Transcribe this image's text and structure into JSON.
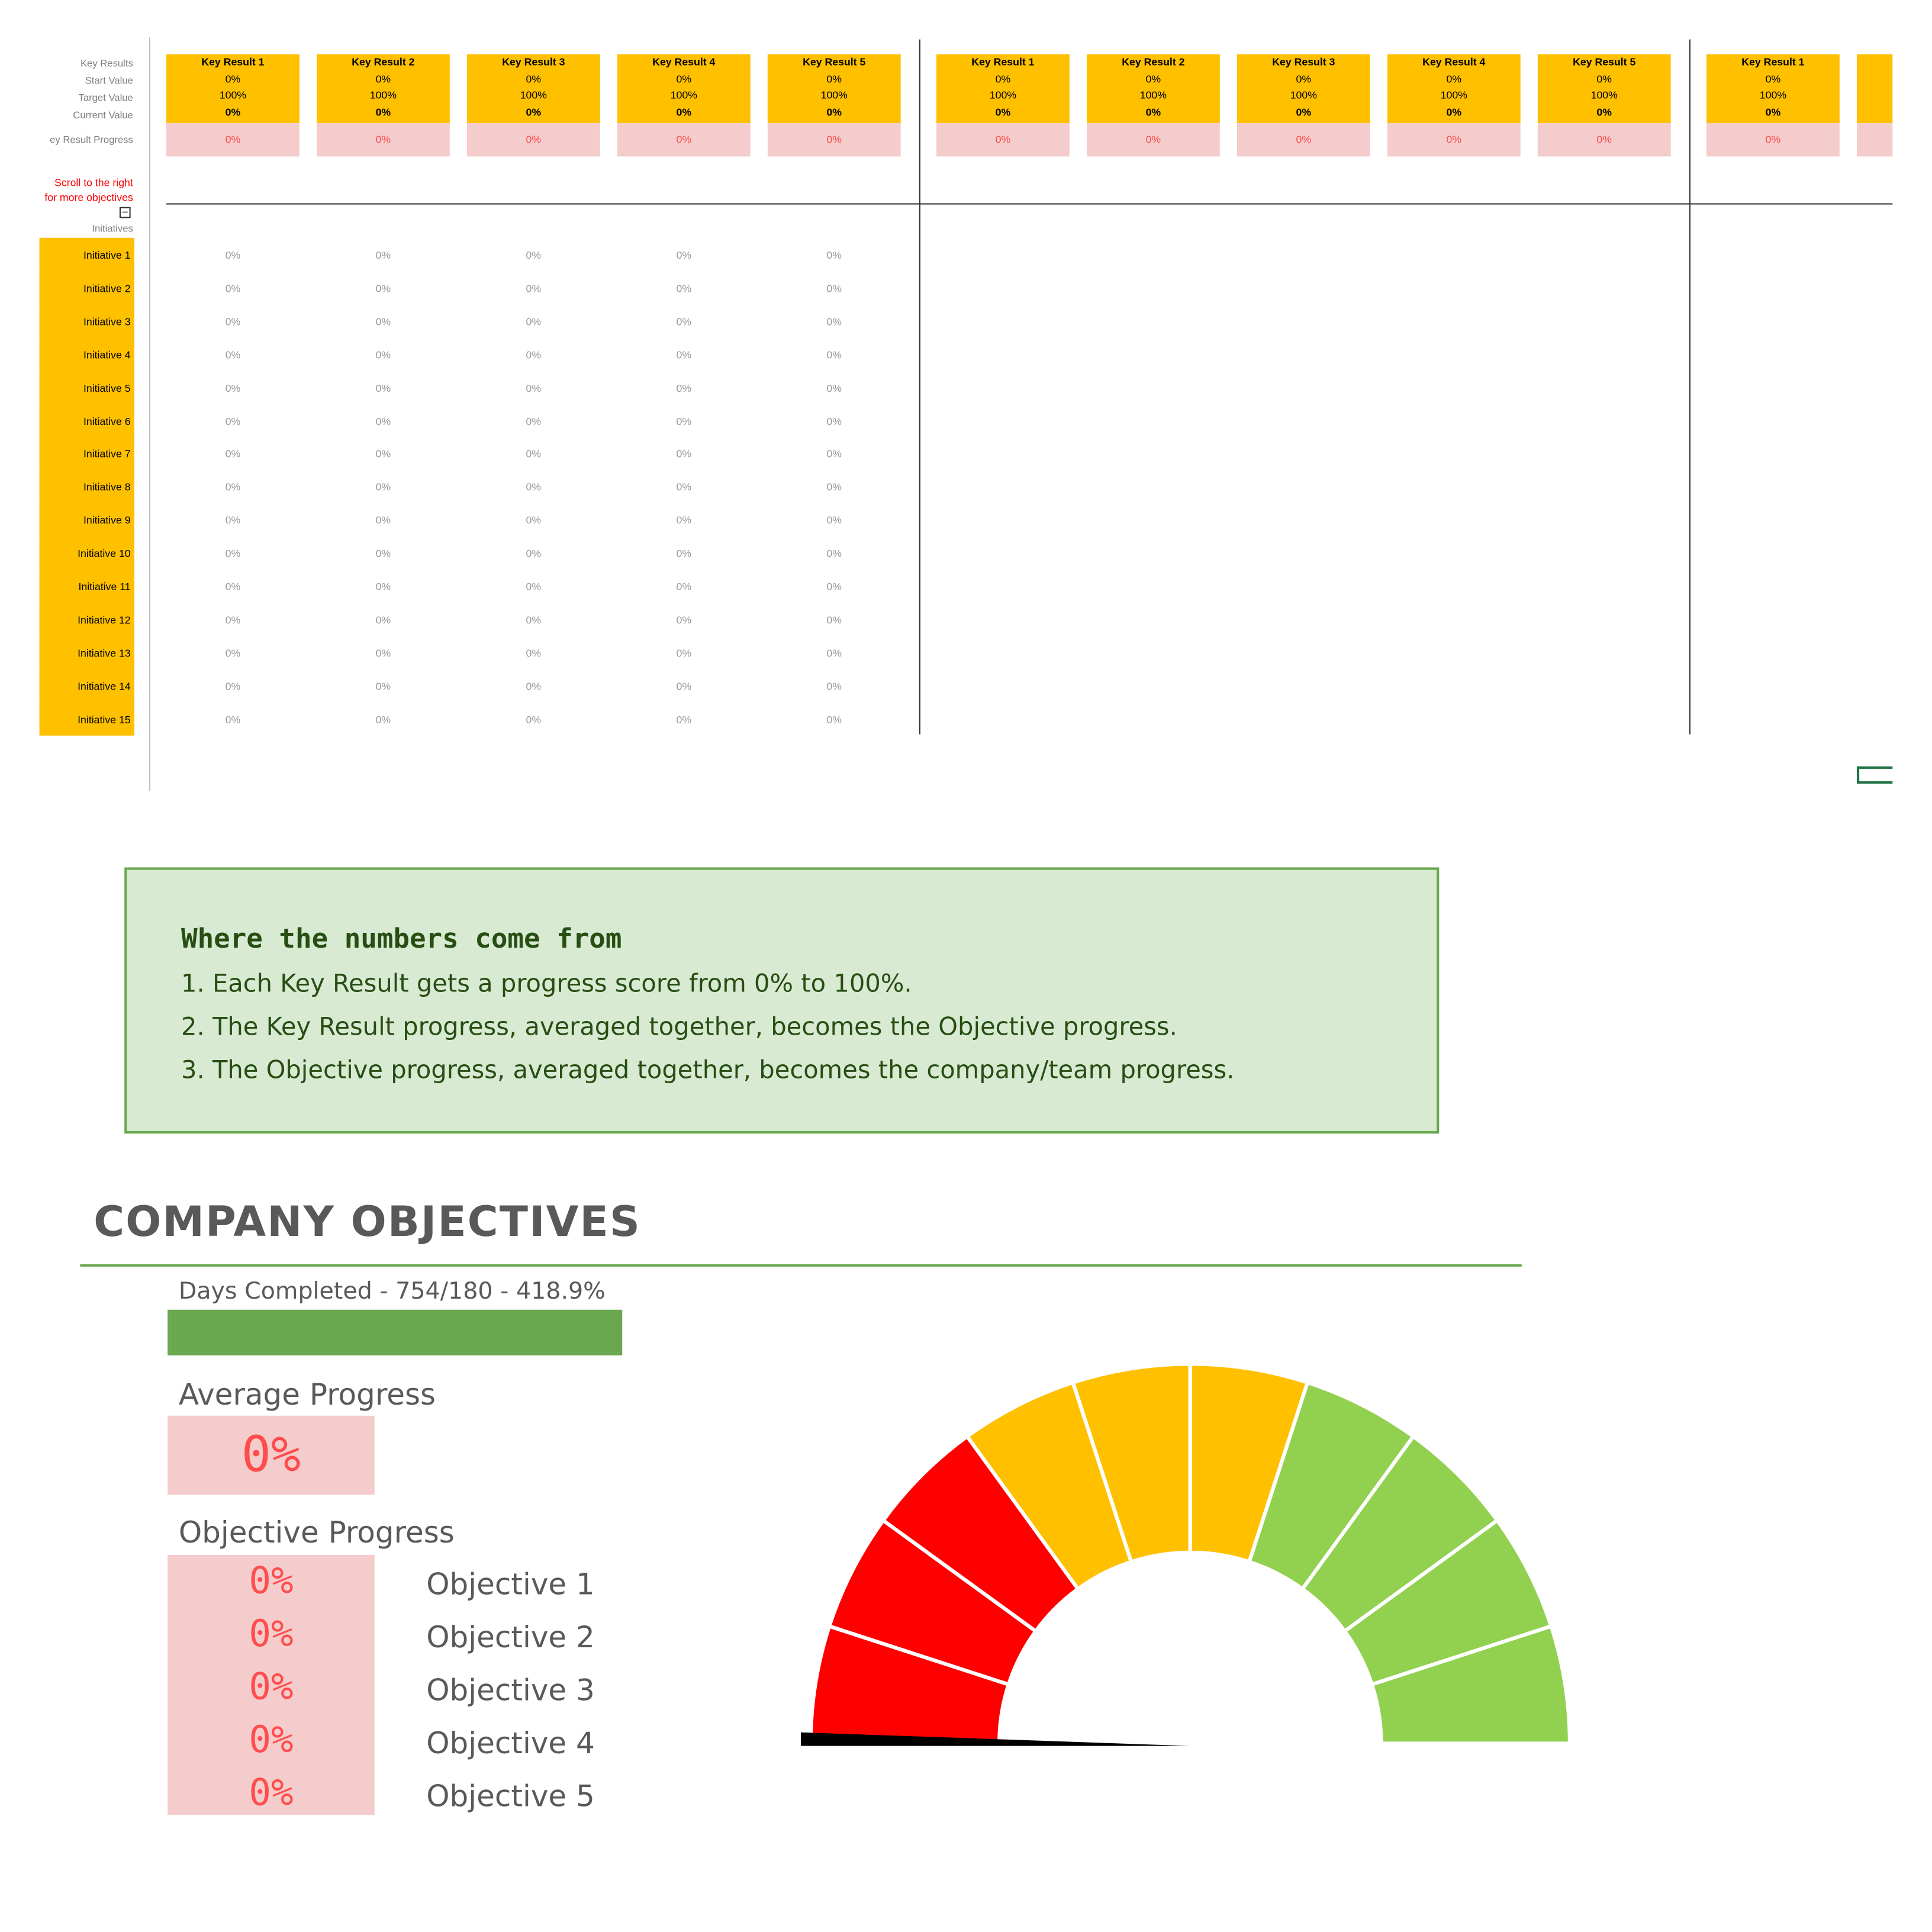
{
  "sheet": {
    "row_labels": {
      "key_results": "Key Results",
      "start_value": "Start Value",
      "target_value": "Target Value",
      "current_value": "Current Value",
      "kr_progress": "ey Result Progress",
      "scroll_note_1": "Scroll to the right",
      "scroll_note_2": "for more objectives",
      "collapse": "−",
      "initiatives": "Initiatives"
    },
    "key_results": [
      {
        "title": "Key Result 1",
        "start": "0%",
        "target": "100%",
        "current": "0%",
        "progress": "0%"
      },
      {
        "title": "Key Result 2",
        "start": "0%",
        "target": "100%",
        "current": "0%",
        "progress": "0%"
      },
      {
        "title": "Key Result 3",
        "start": "0%",
        "target": "100%",
        "current": "0%",
        "progress": "0%"
      },
      {
        "title": "Key Result 4",
        "start": "0%",
        "target": "100%",
        "current": "0%",
        "progress": "0%"
      },
      {
        "title": "Key Result 5",
        "start": "0%",
        "target": "100%",
        "current": "0%",
        "progress": "0%"
      },
      {
        "title": "Key Result 1",
        "start": "0%",
        "target": "100%",
        "current": "0%",
        "progress": "0%"
      },
      {
        "title": "Key Result 2",
        "start": "0%",
        "target": "100%",
        "current": "0%",
        "progress": "0%"
      },
      {
        "title": "Key Result 3",
        "start": "0%",
        "target": "100%",
        "current": "0%",
        "progress": "0%"
      },
      {
        "title": "Key Result 4",
        "start": "0%",
        "target": "100%",
        "current": "0%",
        "progress": "0%"
      },
      {
        "title": "Key Result 5",
        "start": "0%",
        "target": "100%",
        "current": "0%",
        "progress": "0%"
      },
      {
        "title": "Key Result 1",
        "start": "0%",
        "target": "100%",
        "current": "0%",
        "progress": "0%"
      }
    ],
    "initiatives": [
      "Initiative 1",
      "Initiative 2",
      "Initiative 3",
      "Initiative 4",
      "Initiative 5",
      "Initiative 6",
      "Initiative 7",
      "Initiative 8",
      "Initiative 9",
      "Initiative 10",
      "Initiative 11",
      "Initiative 12",
      "Initiative 13",
      "Initiative 14",
      "Initiative 15"
    ],
    "initiative_value": "0%"
  },
  "info": {
    "title": "Where the numbers come from",
    "lines": [
      "1. Each Key Result gets a progress score from 0% to 100%.",
      "2. The Key Result progress, averaged together, becomes the Objective progress.",
      "3. The Objective progress, averaged together, becomes the company/team progress."
    ]
  },
  "dashboard": {
    "title": "COMPANY OBJECTIVES",
    "days_completed": "Days Completed - 754/180 - 418.9%",
    "days_fraction": 1.0,
    "average_label": "Average Progress",
    "average_value": "0%",
    "objective_label": "Objective Progress",
    "objectives": [
      {
        "name": "Objective 1",
        "value": "0%"
      },
      {
        "name": "Objective 2",
        "value": "0%"
      },
      {
        "name": "Objective 3",
        "value": "0%"
      },
      {
        "name": "Objective 4",
        "value": "0%"
      },
      {
        "name": "Objective 5",
        "value": "0%"
      }
    ],
    "gauge": {
      "value_fraction": 0.0,
      "segment_colors": [
        "#FF0000",
        "#FF0000",
        "#FF0000",
        "#FFC000",
        "#FFC000",
        "#FFC000",
        "#92D050",
        "#92D050",
        "#92D050",
        "#92D050"
      ]
    }
  },
  "colors": {
    "kr_header": "#FFC000",
    "progress_bg": "#F4CCCC",
    "progress_text": "#FF4D4D",
    "accent_green": "#6AA84F",
    "info_bg": "#D9EAD3"
  }
}
